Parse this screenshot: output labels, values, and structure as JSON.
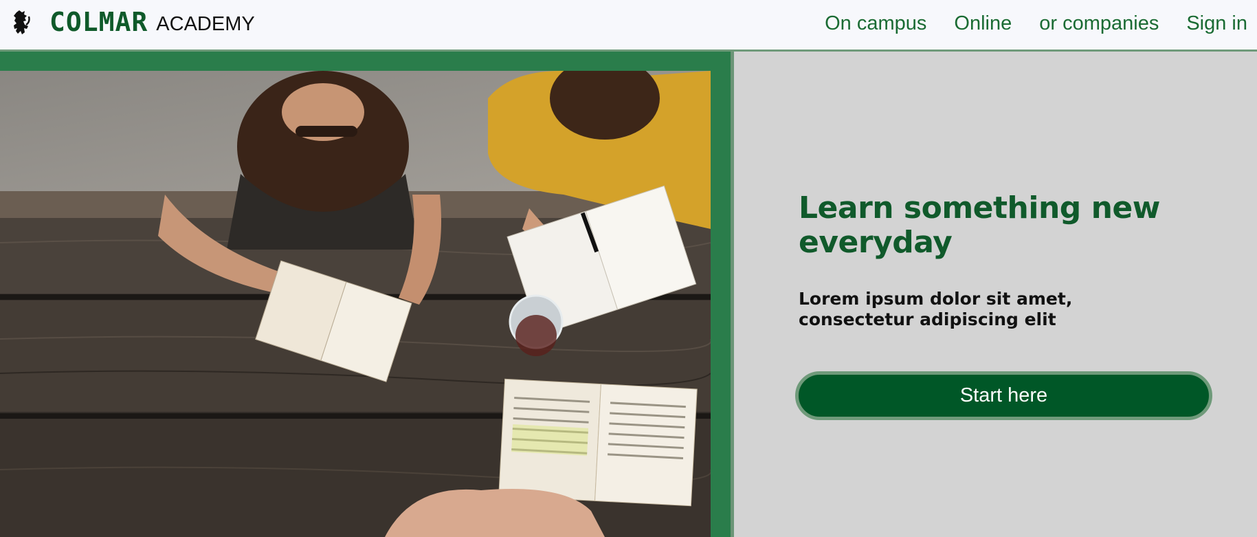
{
  "header": {
    "brand_primary": "COLMAR",
    "brand_secondary": "ACADEMY",
    "logo_icon": "lion-rampant-icon",
    "nav": [
      {
        "label": "On campus"
      },
      {
        "label": "Online"
      },
      {
        "label": "or companies"
      },
      {
        "label": "Sign in"
      }
    ]
  },
  "hero": {
    "headline": "Learn something new everyday",
    "subtext": "Lorem ipsum dolor sit amet, consectetur adipiscing elit",
    "cta_label": "Start here",
    "image_icon": "students-studying-photo"
  },
  "colors": {
    "brand_green": "#0f5a2a",
    "nav_green": "#1a6b33",
    "panel_green": "#2a7d4b",
    "cta_bg": "#005727",
    "cta_border": "#6f9a7a",
    "content_bg": "#d3d3d3",
    "header_bg": "#f7f8fc"
  }
}
